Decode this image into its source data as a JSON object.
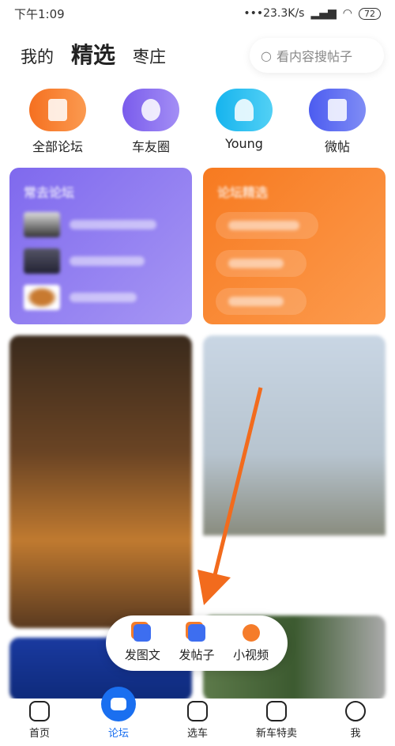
{
  "status": {
    "time": "下午1:09",
    "speed": "•••23.3K/s",
    "battery": "72"
  },
  "tabs": [
    {
      "label": "我的"
    },
    {
      "label": "精选"
    },
    {
      "label": "枣庄"
    }
  ],
  "search": {
    "placeholder": "看内容搜帖子"
  },
  "quick": [
    {
      "label": "全部论坛",
      "color": "#f57c2a"
    },
    {
      "label": "车友圈",
      "color": "#8a6cf0"
    },
    {
      "label": "Young",
      "color": "#2bbcf0"
    },
    {
      "label": "微帖",
      "color": "#5b6cf0"
    }
  ],
  "cards": {
    "frequent": {
      "title": "常去论坛",
      "color": "#8f7cf2"
    },
    "featured": {
      "title": "论坛精选",
      "color": "#fa8a34"
    }
  },
  "popup": [
    {
      "label": "发图文",
      "color": "#3d6ef0"
    },
    {
      "label": "发帖子",
      "color": "#3d6ef0"
    },
    {
      "label": "小视频",
      "color": "#f57c2a"
    }
  ],
  "nav": [
    {
      "label": "首页"
    },
    {
      "label": "论坛"
    },
    {
      "label": "选车"
    },
    {
      "label": "新车特卖"
    },
    {
      "label": "我"
    }
  ],
  "accent": "#1a6ff0"
}
